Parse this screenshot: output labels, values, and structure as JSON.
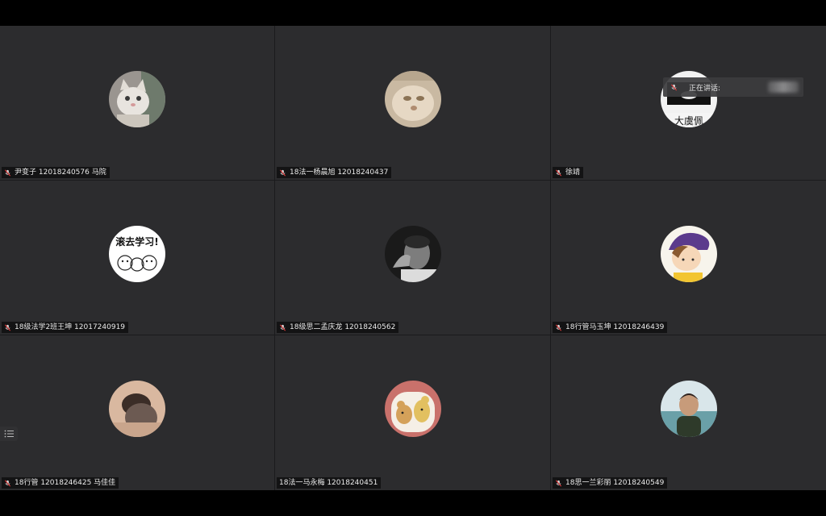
{
  "participants": [
    {
      "name": "尹变子 12018240576 马院",
      "avatar": "cat-white"
    },
    {
      "name": "18法一杨晨旭 12018240437",
      "avatar": "cat-blur"
    },
    {
      "name": "徐靖",
      "avatar": "sticker-text"
    },
    {
      "name": "18级法学2班王坤 12017240919",
      "avatar": "meme-study"
    },
    {
      "name": "18级思二孟庆龙 12018240562",
      "avatar": "bw-portrait"
    },
    {
      "name": "18行管马玉坤 12018246439",
      "avatar": "cartoon-boy"
    },
    {
      "name": "18行管 12018246425 马佳佳",
      "avatar": "hair-photo"
    },
    {
      "name": "18法一马永梅 12018240451",
      "avatar": "cartoon-mice"
    },
    {
      "name": "18思一兰彩丽 12018240549",
      "avatar": "child-photo"
    }
  ],
  "speaking": {
    "label": "正在讲话:"
  },
  "avatar_texts": {
    "meme_study": "滚去学习!",
    "sticker": "大虞佩"
  },
  "colors": {
    "tile_bg": "#2c2c2e",
    "frame_bg": "#000000"
  }
}
